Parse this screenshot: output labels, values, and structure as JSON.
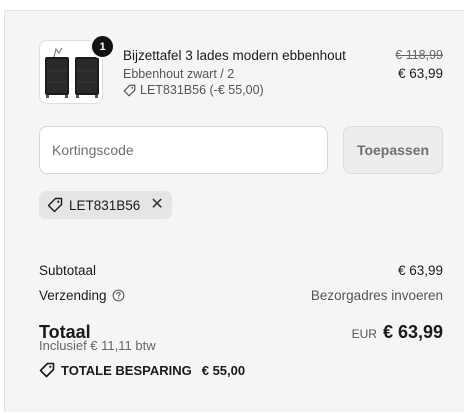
{
  "item": {
    "quantity": "1",
    "name": "Bijzettafel 3 lades modern ebbenhout",
    "variant": "Ebbenhout zwart / 2",
    "discount": "LET831B56 (-€ 55,00)",
    "original_price": "€ 118,99",
    "price": "€ 63,99",
    "image_icon": "nightstand-pair-image"
  },
  "discount_code": {
    "placeholder": "Kortingscode",
    "value": "",
    "apply_label": "Toepassen",
    "applied_code": "LET831B56",
    "tag_icon": "tag-icon",
    "remove_icon": "close-icon"
  },
  "summary": {
    "subtotal_label": "Subtotaal",
    "subtotal_value": "€ 63,99",
    "shipping_label": "Verzending",
    "shipping_value": "Bezorgadres invoeren",
    "total_label": "Totaal",
    "currency": "EUR",
    "total_value": "€ 63,99",
    "tax_note": "Inclusief € 11,11 btw",
    "savings_label": "TOTALE BESPARING",
    "savings_value": "€ 55,00"
  },
  "colors": {
    "panel_bg": "#f5f5f5",
    "text": "#1a1a1a",
    "muted": "#555555",
    "badge": "#111111"
  }
}
